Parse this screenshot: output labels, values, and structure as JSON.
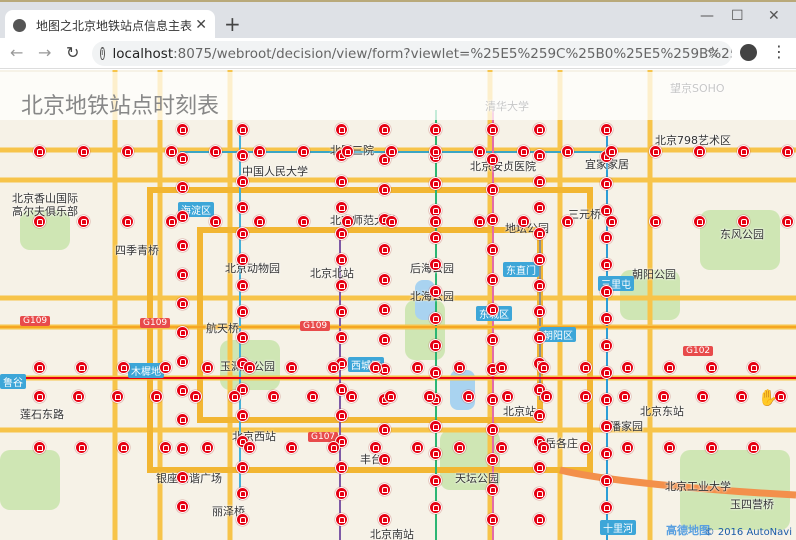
{
  "browser": {
    "tab_title": "地图之北京地铁站点信息主表",
    "url_host": "localhost",
    "url_rest": ":8075/webroot/decision/view/form?viewlet=%25E5%259C%25B0%25E5%259B%25BE%2...",
    "icons": {
      "back": "arrow-left-icon",
      "forward": "arrow-right-icon",
      "reload": "reload-icon",
      "info": "info-icon",
      "star": "star-icon",
      "profile": "account-icon",
      "menu": "more-vert-icon"
    }
  },
  "page": {
    "title": "北京地铁站点时刻表"
  },
  "map": {
    "labels": [
      "清华大学",
      "望京SOHO",
      "北京798艺术区",
      "中国人民大学",
      "北医三院",
      "北京安贞医院",
      "宜家家居",
      "北京香山国际",
      "高尔夫俱乐部",
      "海淀区",
      "北京师范大学",
      "地坛公园",
      "三元桥",
      "东风公园",
      "四季青桥",
      "北京动物园",
      "北京北站",
      "后海公园",
      "东直门",
      "朝阳公园",
      "北海公园",
      "东城区",
      "三里屯",
      "航天桥",
      "G109",
      "G109",
      "G109",
      "朝阳区",
      "G102",
      "玉渊潭公园",
      "西城区",
      "木樨地",
      "北京站",
      "北京东站",
      "莲石东路",
      "北京西站",
      "G107",
      "天坛公园",
      "丰台",
      "银座和谐广场",
      "北京工业大学",
      "潘家园",
      "十里河",
      "丽泽桥",
      "北京南站",
      "玉四营桥",
      "鲁谷",
      "岳各庄"
    ],
    "credit": "© 2016 AutoNavi",
    "provider_logo": "高德地图",
    "station_color": "#e60012"
  }
}
